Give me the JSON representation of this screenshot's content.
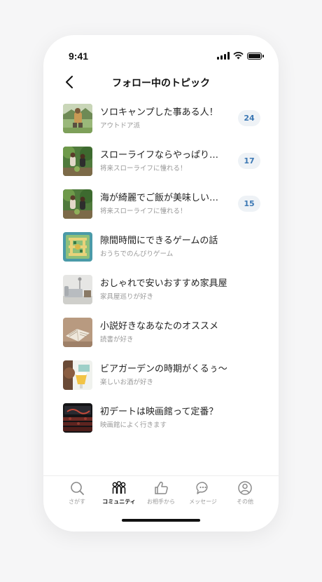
{
  "status": {
    "time": "9:41"
  },
  "header": {
    "title": "フォロー中のトピック"
  },
  "topics": [
    {
      "title": "ソロキャンプした事ある人！",
      "category": "アウトドア派",
      "count": "24",
      "thumb": "camping-photo"
    },
    {
      "title": "スローライフならやっぱり…",
      "category": "将来スローライフに憧れる！",
      "count": "17",
      "thumb": "garden-photo"
    },
    {
      "title": "海が綺麗でご飯が美味しい…",
      "category": "将来スローライフに憧れる！",
      "count": "15",
      "thumb": "garden-photo"
    },
    {
      "title": "隙間時間にできるゲームの話",
      "category": "おうちでのんびりゲーム",
      "count": "",
      "thumb": "game-board-photo"
    },
    {
      "title": "おしゃれで安いおすすめ家具屋",
      "category": "家具屋巡りが好き",
      "count": "",
      "thumb": "sofa-photo"
    },
    {
      "title": "小説好きなあなたのオススメ",
      "category": "読書が好き",
      "count": "",
      "thumb": "book-photo"
    },
    {
      "title": "ビアガーデンの時期がくるぅ～",
      "category": "楽しいお酒が好き",
      "count": "",
      "thumb": "beer-photo"
    },
    {
      "title": "初デートは映画館って定番？",
      "category": "映画館によく行きます",
      "count": "",
      "thumb": "cinema-photo"
    }
  ],
  "tabbar": {
    "tabs": [
      {
        "label": "さがす",
        "icon": "search-icon"
      },
      {
        "label": "コミュニティ",
        "icon": "community-icon",
        "active": true
      },
      {
        "label": "お相手から",
        "icon": "thumbs-up-icon"
      },
      {
        "label": "メッセージ",
        "icon": "message-icon"
      },
      {
        "label": "その他",
        "icon": "profile-icon"
      }
    ]
  },
  "colors": {
    "badge_text": "#3c78b4",
    "badge_bg": "#eef2f6",
    "active_tab": "#111111",
    "inactive_tab": "#999999"
  }
}
